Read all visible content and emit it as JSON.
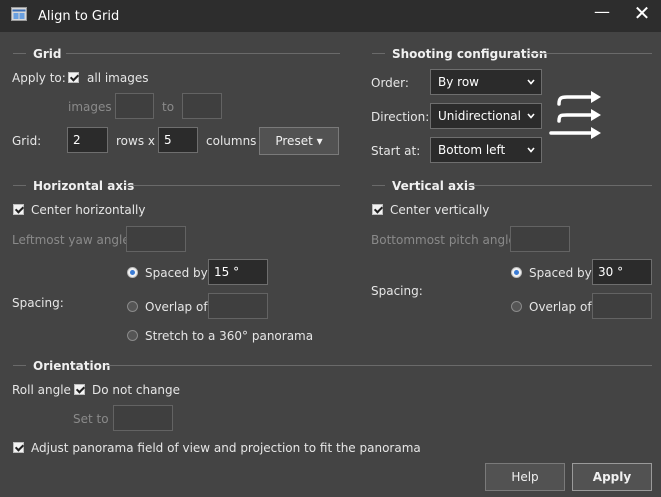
{
  "window": {
    "title": "Align to Grid",
    "minimize_glyph": "—",
    "close_glyph": "✕"
  },
  "grid": {
    "title": "Grid",
    "apply_to_label": "Apply to:",
    "all_images_label": "all images",
    "all_images_checked": true,
    "images_label": "images",
    "images_from": "",
    "to_label": "to",
    "images_to": "",
    "grid_label": "Grid:",
    "rows": "2",
    "rows_label": "rows x",
    "columns": "5",
    "columns_label": "columns",
    "preset_label": "Preset ▾"
  },
  "shooting": {
    "title": "Shooting configuration",
    "order_label": "Order:",
    "order_value": "By row",
    "direction_label": "Direction:",
    "direction_value": "Unidirectional",
    "start_label": "Start at:",
    "start_value": "Bottom left",
    "diagram_icon": "unidirectional-rows-arrows-icon"
  },
  "horizontal": {
    "title": "Horizontal axis",
    "center_label": "Center horizontally",
    "center_checked": true,
    "leftmost_label": "Leftmost yaw angle:",
    "leftmost_value": "",
    "spacing_label": "Spacing:",
    "spaced_by_label": "Spaced by",
    "spaced_by_value": "15 °",
    "overlap_label": "Overlap of",
    "overlap_value": "",
    "stretch_label": "Stretch to a 360° panorama",
    "selected": "spaced_by"
  },
  "vertical": {
    "title": "Vertical axis",
    "center_label": "Center vertically",
    "center_checked": true,
    "bottommost_label": "Bottommost pitch angle:",
    "bottommost_value": "",
    "spacing_label": "Spacing:",
    "spaced_by_label": "Spaced by",
    "spaced_by_value": "30 °",
    "overlap_label": "Overlap of",
    "overlap_value": "",
    "selected": "spaced_by"
  },
  "orientation": {
    "title": "Orientation",
    "roll_label": "Roll angle",
    "do_not_change_label": "Do not change",
    "do_not_change_checked": true,
    "set_to_label": "Set to",
    "set_to_value": ""
  },
  "adjust_label": "Adjust panorama field of view and projection to fit the panorama",
  "adjust_checked": true,
  "buttons": {
    "help": "Help",
    "apply": "Apply"
  },
  "colors": {
    "background": "#444444",
    "titlebar": "#2d2d2d",
    "field": "#2b2b2b",
    "radio_accent": "#3a7bd5"
  }
}
